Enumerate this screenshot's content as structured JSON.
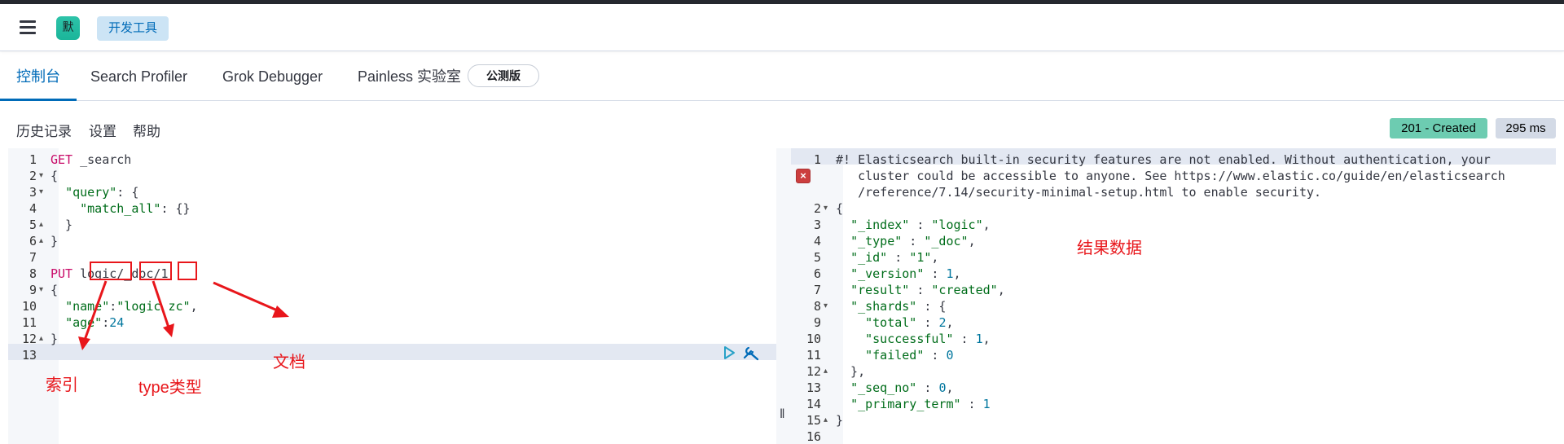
{
  "header": {
    "avatar_letter": "默",
    "breadcrumb": "开发工具"
  },
  "tabs": [
    {
      "label": "控制台",
      "active": true
    },
    {
      "label": "Search Profiler"
    },
    {
      "label": "Grok Debugger"
    },
    {
      "label": "Painless 实验室"
    }
  ],
  "beta_badge": "公测版",
  "toolbar": {
    "history": "历史记录",
    "settings": "设置",
    "help": "帮助"
  },
  "response": {
    "status": "201 - Created",
    "time": "295 ms"
  },
  "request": {
    "line_numbers": [
      "1",
      "2",
      "3",
      "4",
      "5",
      "6",
      "7",
      "8",
      "9",
      "10",
      "11",
      "12",
      "13"
    ],
    "lines": [
      {
        "tokens": [
          {
            "t": "kw",
            "v": "GET"
          },
          {
            "t": "plain",
            "v": " _search"
          }
        ]
      },
      {
        "tokens": [
          {
            "t": "plain",
            "v": "{"
          }
        ]
      },
      {
        "tokens": [
          {
            "t": "plain",
            "v": "  "
          },
          {
            "t": "str",
            "v": "\"query\""
          },
          {
            "t": "plain",
            "v": ": {"
          }
        ]
      },
      {
        "tokens": [
          {
            "t": "plain",
            "v": "    "
          },
          {
            "t": "str",
            "v": "\"match_all\""
          },
          {
            "t": "plain",
            "v": ": {}"
          }
        ]
      },
      {
        "tokens": [
          {
            "t": "plain",
            "v": "  }"
          }
        ]
      },
      {
        "tokens": [
          {
            "t": "plain",
            "v": "}"
          }
        ]
      },
      {
        "tokens": []
      },
      {
        "tokens": [
          {
            "t": "kw",
            "v": "PUT"
          },
          {
            "t": "plain",
            "v": " logic/_doc/1"
          }
        ]
      },
      {
        "tokens": [
          {
            "t": "plain",
            "v": "{"
          }
        ]
      },
      {
        "tokens": [
          {
            "t": "plain",
            "v": "  "
          },
          {
            "t": "str",
            "v": "\"name\""
          },
          {
            "t": "plain",
            "v": ":"
          },
          {
            "t": "str",
            "v": "\"logic zc\""
          },
          {
            "t": "plain",
            "v": ","
          }
        ]
      },
      {
        "tokens": [
          {
            "t": "plain",
            "v": "  "
          },
          {
            "t": "str",
            "v": "\"age\""
          },
          {
            "t": "plain",
            "v": ":"
          },
          {
            "t": "num",
            "v": "24"
          }
        ]
      },
      {
        "tokens": [
          {
            "t": "plain",
            "v": "}"
          }
        ]
      },
      {
        "tokens": []
      }
    ]
  },
  "output": {
    "line_numbers": [
      "1",
      "",
      "",
      "2",
      "3",
      "4",
      "5",
      "6",
      "7",
      "8",
      "9",
      "10",
      "11",
      "12",
      "13",
      "14",
      "15",
      "16"
    ],
    "lines": [
      {
        "tokens": [
          {
            "t": "plain",
            "v": "#! Elasticsearch built-in security features are not enabled. Without authentication, your"
          }
        ]
      },
      {
        "tokens": [
          {
            "t": "plain",
            "v": "   cluster could be accessible to anyone. See https://www.elastic.co/guide/en/elasticsearch"
          }
        ]
      },
      {
        "tokens": [
          {
            "t": "plain",
            "v": "   /reference/7.14/security-minimal-setup.html to enable security."
          }
        ]
      },
      {
        "tokens": [
          {
            "t": "plain",
            "v": "{"
          }
        ]
      },
      {
        "tokens": [
          {
            "t": "plain",
            "v": "  "
          },
          {
            "t": "str",
            "v": "\"_index\""
          },
          {
            "t": "plain",
            "v": " : "
          },
          {
            "t": "str",
            "v": "\"logic\""
          },
          {
            "t": "plain",
            "v": ","
          }
        ]
      },
      {
        "tokens": [
          {
            "t": "plain",
            "v": "  "
          },
          {
            "t": "str",
            "v": "\"_type\""
          },
          {
            "t": "plain",
            "v": " : "
          },
          {
            "t": "str",
            "v": "\"_doc\""
          },
          {
            "t": "plain",
            "v": ","
          }
        ]
      },
      {
        "tokens": [
          {
            "t": "plain",
            "v": "  "
          },
          {
            "t": "str",
            "v": "\"_id\""
          },
          {
            "t": "plain",
            "v": " : "
          },
          {
            "t": "str",
            "v": "\"1\""
          },
          {
            "t": "plain",
            "v": ","
          }
        ]
      },
      {
        "tokens": [
          {
            "t": "plain",
            "v": "  "
          },
          {
            "t": "str",
            "v": "\"_version\""
          },
          {
            "t": "plain",
            "v": " : "
          },
          {
            "t": "num",
            "v": "1"
          },
          {
            "t": "plain",
            "v": ","
          }
        ]
      },
      {
        "tokens": [
          {
            "t": "plain",
            "v": "  "
          },
          {
            "t": "str",
            "v": "\"result\""
          },
          {
            "t": "plain",
            "v": " : "
          },
          {
            "t": "str",
            "v": "\"created\""
          },
          {
            "t": "plain",
            "v": ","
          }
        ]
      },
      {
        "tokens": [
          {
            "t": "plain",
            "v": "  "
          },
          {
            "t": "str",
            "v": "\"_shards\""
          },
          {
            "t": "plain",
            "v": " : {"
          }
        ]
      },
      {
        "tokens": [
          {
            "t": "plain",
            "v": "    "
          },
          {
            "t": "str",
            "v": "\"total\""
          },
          {
            "t": "plain",
            "v": " : "
          },
          {
            "t": "num",
            "v": "2"
          },
          {
            "t": "plain",
            "v": ","
          }
        ]
      },
      {
        "tokens": [
          {
            "t": "plain",
            "v": "    "
          },
          {
            "t": "str",
            "v": "\"successful\""
          },
          {
            "t": "plain",
            "v": " : "
          },
          {
            "t": "num",
            "v": "1"
          },
          {
            "t": "plain",
            "v": ","
          }
        ]
      },
      {
        "tokens": [
          {
            "t": "plain",
            "v": "    "
          },
          {
            "t": "str",
            "v": "\"failed\""
          },
          {
            "t": "plain",
            "v": " : "
          },
          {
            "t": "num",
            "v": "0"
          }
        ]
      },
      {
        "tokens": [
          {
            "t": "plain",
            "v": "  },"
          }
        ]
      },
      {
        "tokens": [
          {
            "t": "plain",
            "v": "  "
          },
          {
            "t": "str",
            "v": "\"_seq_no\""
          },
          {
            "t": "plain",
            "v": " : "
          },
          {
            "t": "num",
            "v": "0"
          },
          {
            "t": "plain",
            "v": ","
          }
        ]
      },
      {
        "tokens": [
          {
            "t": "plain",
            "v": "  "
          },
          {
            "t": "str",
            "v": "\"_primary_term\""
          },
          {
            "t": "plain",
            "v": " : "
          },
          {
            "t": "num",
            "v": "1"
          }
        ]
      },
      {
        "tokens": [
          {
            "t": "plain",
            "v": "}"
          }
        ]
      },
      {
        "tokens": []
      }
    ]
  },
  "annotations": {
    "result_label": "结果数据",
    "index_label": "索引",
    "type_label": "type类型",
    "doc_label": "文档"
  },
  "colors": {
    "accent": "#006bb8",
    "keyword": "#c80a68",
    "string": "#006d1a",
    "number": "#00769e",
    "annotation": "#e8161b",
    "status": "#6dccb1"
  }
}
